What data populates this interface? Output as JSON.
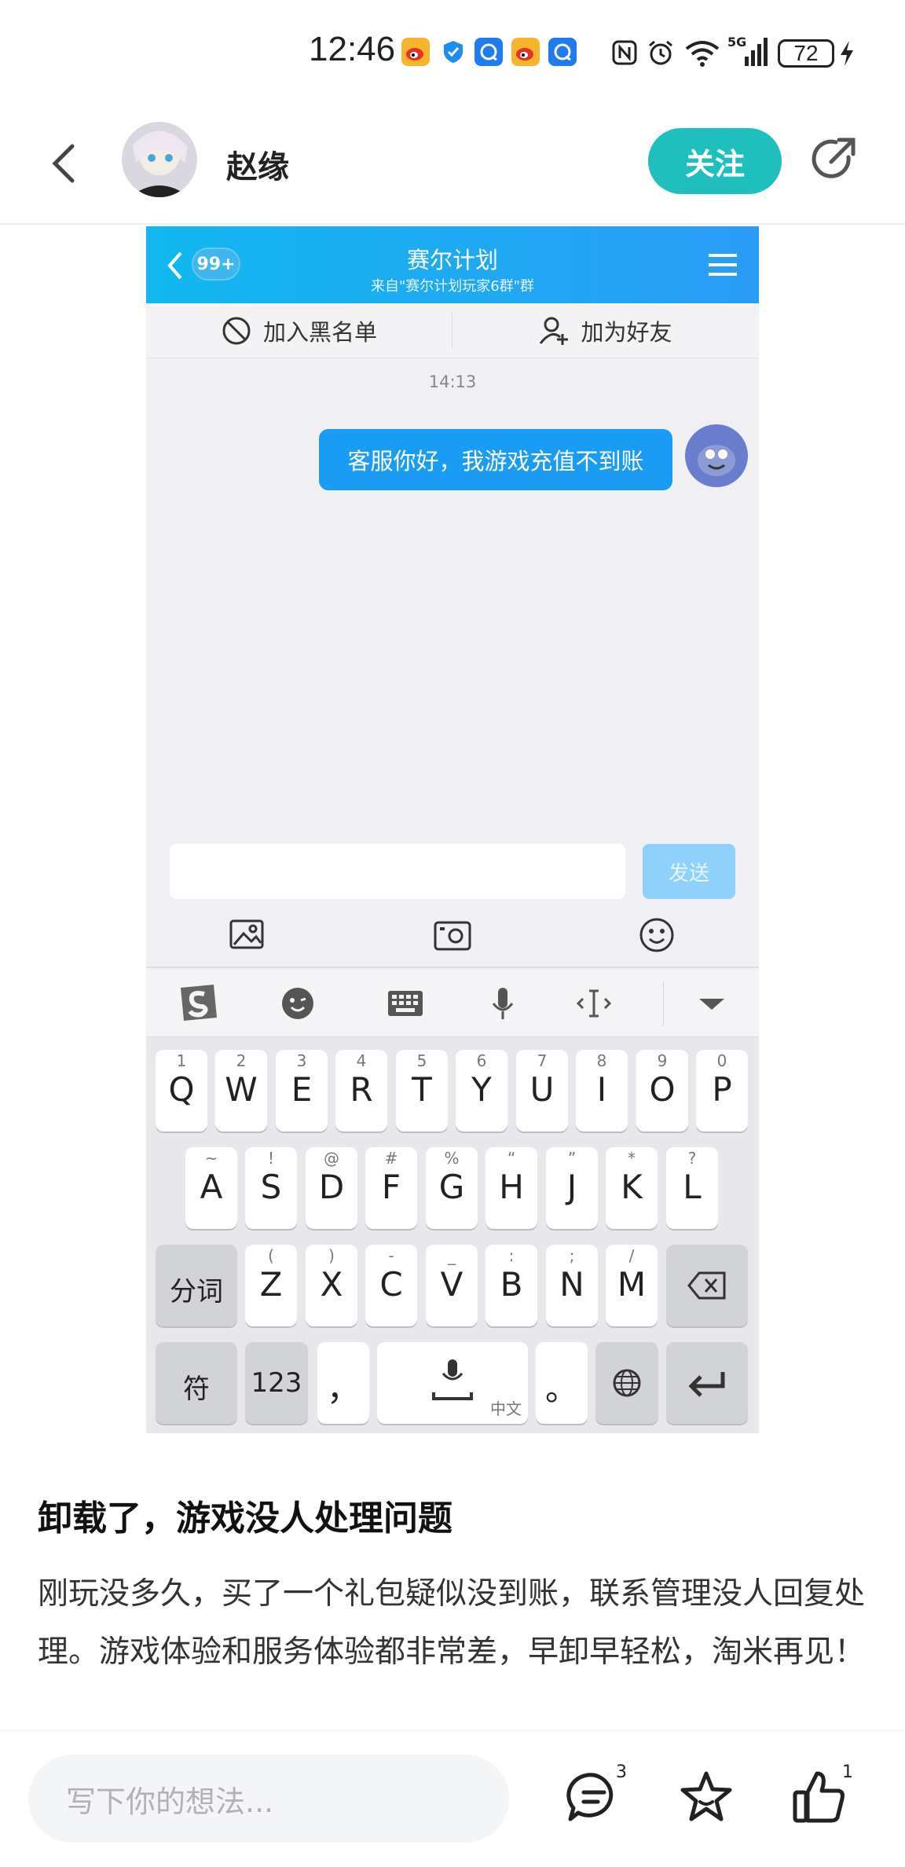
{
  "status_bar": {
    "time": "12:46",
    "battery": "72",
    "network": "5G",
    "icons": [
      "weibo-icon",
      "shield-icon",
      "message-icon",
      "weibo-icon",
      "message-icon",
      "nfc-icon",
      "alarm-icon",
      "wifi-icon",
      "signal-icon",
      "charging-icon"
    ]
  },
  "header": {
    "username": "赵缘",
    "follow_label": "关注",
    "icons": [
      "back-icon",
      "share-icon"
    ]
  },
  "screenshot": {
    "badge": "99+",
    "chat_title": "赛尔计划",
    "chat_subtitle": "来自\"赛尔计划玩家6群\"群",
    "blacklist_label": "加入黑名单",
    "add_friend_label": "加为好友",
    "timestamp": "14:13",
    "message": "客服你好，我游戏充值不到账",
    "send_label": "发送",
    "keyboard": {
      "row1": [
        {
          "hint": "1",
          "key": "Q"
        },
        {
          "hint": "2",
          "key": "W"
        },
        {
          "hint": "3",
          "key": "E"
        },
        {
          "hint": "4",
          "key": "R"
        },
        {
          "hint": "5",
          "key": "T"
        },
        {
          "hint": "6",
          "key": "Y"
        },
        {
          "hint": "7",
          "key": "U"
        },
        {
          "hint": "8",
          "key": "I"
        },
        {
          "hint": "9",
          "key": "O"
        },
        {
          "hint": "0",
          "key": "P"
        }
      ],
      "row2": [
        {
          "hint": "~",
          "key": "A"
        },
        {
          "hint": "!",
          "key": "S"
        },
        {
          "hint": "@",
          "key": "D"
        },
        {
          "hint": "#",
          "key": "F"
        },
        {
          "hint": "%",
          "key": "G"
        },
        {
          "hint": "“",
          "key": "H"
        },
        {
          "hint": "”",
          "key": "J"
        },
        {
          "hint": "*",
          "key": "K"
        },
        {
          "hint": "?",
          "key": "L"
        }
      ],
      "row3": [
        {
          "hint": "(",
          "key": "Z"
        },
        {
          "hint": ")",
          "key": "X"
        },
        {
          "hint": "-",
          "key": "C"
        },
        {
          "hint": "_",
          "key": "V"
        },
        {
          "hint": ":",
          "key": "B"
        },
        {
          "hint": ";",
          "key": "N"
        },
        {
          "hint": "/",
          "key": "M"
        }
      ],
      "segment_key": "分词",
      "symbol_key": "符",
      "number_key": "123",
      "comma_key": "，",
      "period_key": "。",
      "space_hint": "中文"
    }
  },
  "post": {
    "title": "卸载了，游戏没人处理问题",
    "body": "刚玩没多久，买了一个礼包疑似没到账，联系管理没人回复处理。游戏体验和服务体验都非常差，早卸早轻松，淘米再见！"
  },
  "bottom_bar": {
    "comment_placeholder": "写下你的想法...",
    "comment_count": "3",
    "like_count": "1"
  },
  "colors": {
    "accent": "#1fbfbd",
    "chat_blue": "#1a9cf4"
  }
}
